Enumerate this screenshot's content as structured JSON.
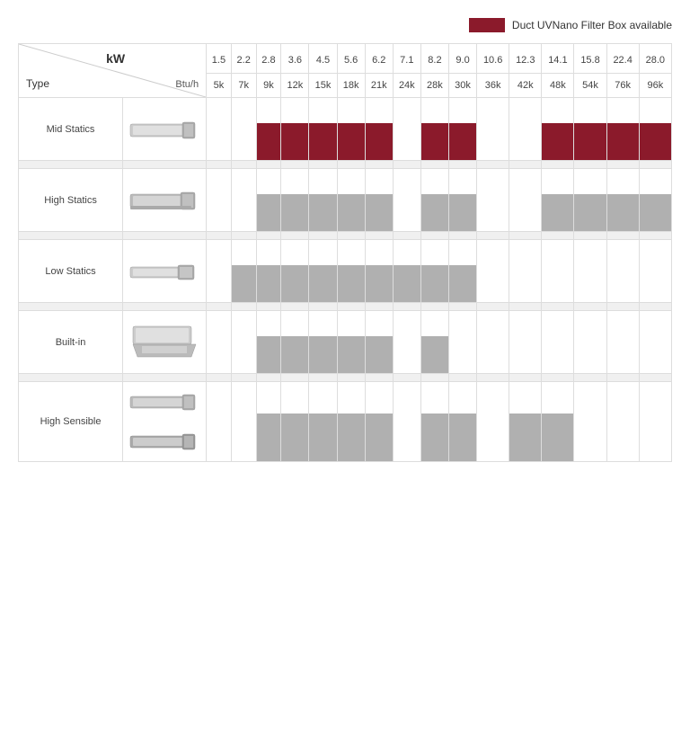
{
  "legend": {
    "label": "Duct UVNano Filter Box available"
  },
  "header": {
    "kw_label": "kW",
    "btu_label": "Btu/h",
    "type_label": "Type",
    "kw_values": [
      "1.5",
      "2.2",
      "2.8",
      "3.6",
      "4.5",
      "5.6",
      "6.2",
      "7.1",
      "8.2",
      "9.0",
      "10.6",
      "12.3",
      "14.1",
      "15.8",
      "22.4",
      "28.0"
    ],
    "btu_values": [
      "5k",
      "7k",
      "9k",
      "12k",
      "15k",
      "18k",
      "21k",
      "24k",
      "28k",
      "30k",
      "36k",
      "42k",
      "48k",
      "54k",
      "76k",
      "96k"
    ]
  },
  "products": [
    {
      "name": "Mid Statics",
      "image_desc": "duct-mid-statics",
      "bars": [
        "empty",
        "empty",
        "red",
        "red",
        "red",
        "red",
        "red",
        "empty",
        "red",
        "red",
        "empty",
        "empty",
        "red",
        "red",
        "red",
        "red"
      ]
    },
    {
      "name": "High Statics",
      "image_desc": "duct-high-statics",
      "bars": [
        "empty",
        "empty",
        "gray",
        "gray",
        "gray",
        "gray",
        "gray",
        "empty",
        "gray",
        "gray",
        "empty",
        "empty",
        "gray",
        "gray",
        "gray",
        "gray"
      ]
    },
    {
      "name": "Low Statics",
      "image_desc": "duct-low-statics",
      "bars": [
        "empty",
        "gray",
        "gray",
        "gray",
        "gray",
        "gray",
        "gray",
        "gray",
        "gray",
        "gray",
        "empty",
        "empty",
        "empty",
        "empty",
        "empty",
        "empty"
      ]
    },
    {
      "name": "Built-in",
      "image_desc": "duct-built-in",
      "bars": [
        "empty",
        "empty",
        "gray",
        "gray",
        "gray",
        "gray",
        "gray",
        "empty",
        "gray",
        "empty",
        "empty",
        "empty",
        "empty",
        "empty",
        "empty",
        "empty"
      ]
    },
    {
      "name": "High Sensible",
      "image_desc": "duct-high-sensible",
      "bars": [
        "empty",
        "empty",
        "gray",
        "gray",
        "gray",
        "gray",
        "gray",
        "empty",
        "gray",
        "gray",
        "empty",
        "gray",
        "gray",
        "empty",
        "empty",
        "empty"
      ]
    }
  ]
}
